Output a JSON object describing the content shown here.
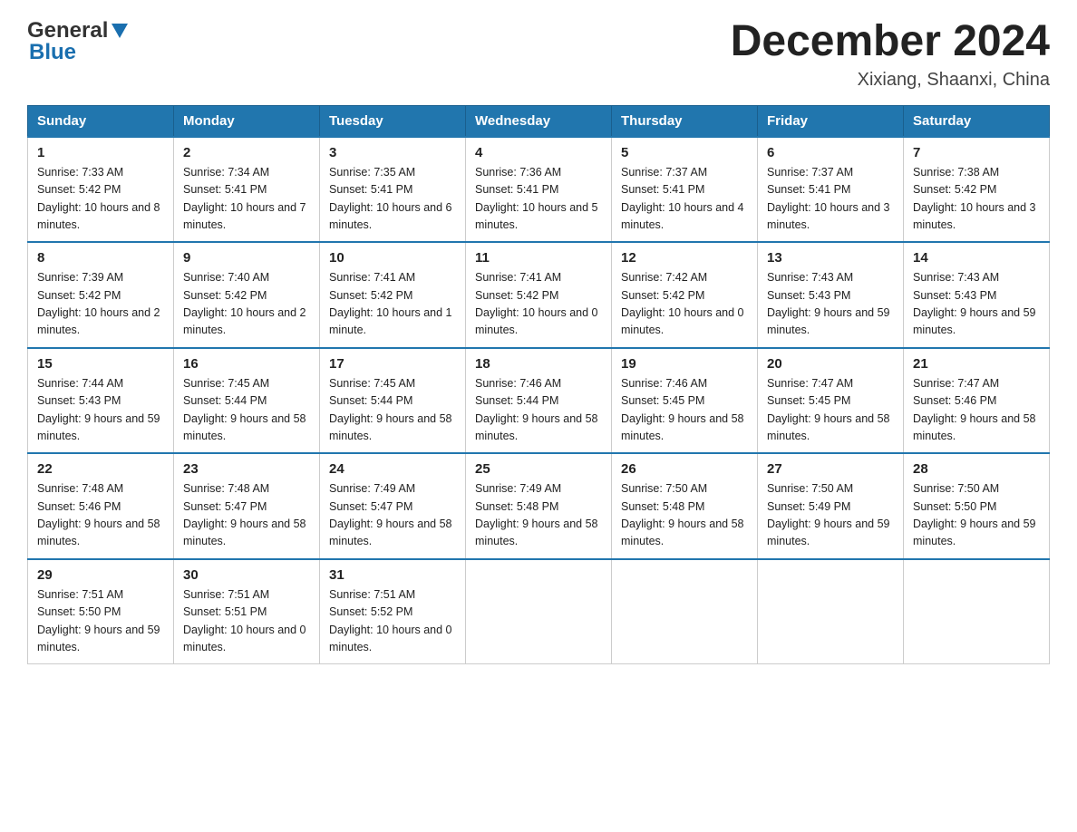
{
  "header": {
    "logo_general": "General",
    "logo_blue": "Blue",
    "month_year": "December 2024",
    "location": "Xixiang, Shaanxi, China"
  },
  "columns": [
    "Sunday",
    "Monday",
    "Tuesday",
    "Wednesday",
    "Thursday",
    "Friday",
    "Saturday"
  ],
  "weeks": [
    [
      {
        "day": "1",
        "sunrise": "7:33 AM",
        "sunset": "5:42 PM",
        "daylight": "10 hours and 8 minutes."
      },
      {
        "day": "2",
        "sunrise": "7:34 AM",
        "sunset": "5:41 PM",
        "daylight": "10 hours and 7 minutes."
      },
      {
        "day": "3",
        "sunrise": "7:35 AM",
        "sunset": "5:41 PM",
        "daylight": "10 hours and 6 minutes."
      },
      {
        "day": "4",
        "sunrise": "7:36 AM",
        "sunset": "5:41 PM",
        "daylight": "10 hours and 5 minutes."
      },
      {
        "day": "5",
        "sunrise": "7:37 AM",
        "sunset": "5:41 PM",
        "daylight": "10 hours and 4 minutes."
      },
      {
        "day": "6",
        "sunrise": "7:37 AM",
        "sunset": "5:41 PM",
        "daylight": "10 hours and 3 minutes."
      },
      {
        "day": "7",
        "sunrise": "7:38 AM",
        "sunset": "5:42 PM",
        "daylight": "10 hours and 3 minutes."
      }
    ],
    [
      {
        "day": "8",
        "sunrise": "7:39 AM",
        "sunset": "5:42 PM",
        "daylight": "10 hours and 2 minutes."
      },
      {
        "day": "9",
        "sunrise": "7:40 AM",
        "sunset": "5:42 PM",
        "daylight": "10 hours and 2 minutes."
      },
      {
        "day": "10",
        "sunrise": "7:41 AM",
        "sunset": "5:42 PM",
        "daylight": "10 hours and 1 minute."
      },
      {
        "day": "11",
        "sunrise": "7:41 AM",
        "sunset": "5:42 PM",
        "daylight": "10 hours and 0 minutes."
      },
      {
        "day": "12",
        "sunrise": "7:42 AM",
        "sunset": "5:42 PM",
        "daylight": "10 hours and 0 minutes."
      },
      {
        "day": "13",
        "sunrise": "7:43 AM",
        "sunset": "5:43 PM",
        "daylight": "9 hours and 59 minutes."
      },
      {
        "day": "14",
        "sunrise": "7:43 AM",
        "sunset": "5:43 PM",
        "daylight": "9 hours and 59 minutes."
      }
    ],
    [
      {
        "day": "15",
        "sunrise": "7:44 AM",
        "sunset": "5:43 PM",
        "daylight": "9 hours and 59 minutes."
      },
      {
        "day": "16",
        "sunrise": "7:45 AM",
        "sunset": "5:44 PM",
        "daylight": "9 hours and 58 minutes."
      },
      {
        "day": "17",
        "sunrise": "7:45 AM",
        "sunset": "5:44 PM",
        "daylight": "9 hours and 58 minutes."
      },
      {
        "day": "18",
        "sunrise": "7:46 AM",
        "sunset": "5:44 PM",
        "daylight": "9 hours and 58 minutes."
      },
      {
        "day": "19",
        "sunrise": "7:46 AM",
        "sunset": "5:45 PM",
        "daylight": "9 hours and 58 minutes."
      },
      {
        "day": "20",
        "sunrise": "7:47 AM",
        "sunset": "5:45 PM",
        "daylight": "9 hours and 58 minutes."
      },
      {
        "day": "21",
        "sunrise": "7:47 AM",
        "sunset": "5:46 PM",
        "daylight": "9 hours and 58 minutes."
      }
    ],
    [
      {
        "day": "22",
        "sunrise": "7:48 AM",
        "sunset": "5:46 PM",
        "daylight": "9 hours and 58 minutes."
      },
      {
        "day": "23",
        "sunrise": "7:48 AM",
        "sunset": "5:47 PM",
        "daylight": "9 hours and 58 minutes."
      },
      {
        "day": "24",
        "sunrise": "7:49 AM",
        "sunset": "5:47 PM",
        "daylight": "9 hours and 58 minutes."
      },
      {
        "day": "25",
        "sunrise": "7:49 AM",
        "sunset": "5:48 PM",
        "daylight": "9 hours and 58 minutes."
      },
      {
        "day": "26",
        "sunrise": "7:50 AM",
        "sunset": "5:48 PM",
        "daylight": "9 hours and 58 minutes."
      },
      {
        "day": "27",
        "sunrise": "7:50 AM",
        "sunset": "5:49 PM",
        "daylight": "9 hours and 59 minutes."
      },
      {
        "day": "28",
        "sunrise": "7:50 AM",
        "sunset": "5:50 PM",
        "daylight": "9 hours and 59 minutes."
      }
    ],
    [
      {
        "day": "29",
        "sunrise": "7:51 AM",
        "sunset": "5:50 PM",
        "daylight": "9 hours and 59 minutes."
      },
      {
        "day": "30",
        "sunrise": "7:51 AM",
        "sunset": "5:51 PM",
        "daylight": "10 hours and 0 minutes."
      },
      {
        "day": "31",
        "sunrise": "7:51 AM",
        "sunset": "5:52 PM",
        "daylight": "10 hours and 0 minutes."
      },
      null,
      null,
      null,
      null
    ]
  ],
  "labels": {
    "sunrise": "Sunrise:",
    "sunset": "Sunset:",
    "daylight": "Daylight:"
  }
}
